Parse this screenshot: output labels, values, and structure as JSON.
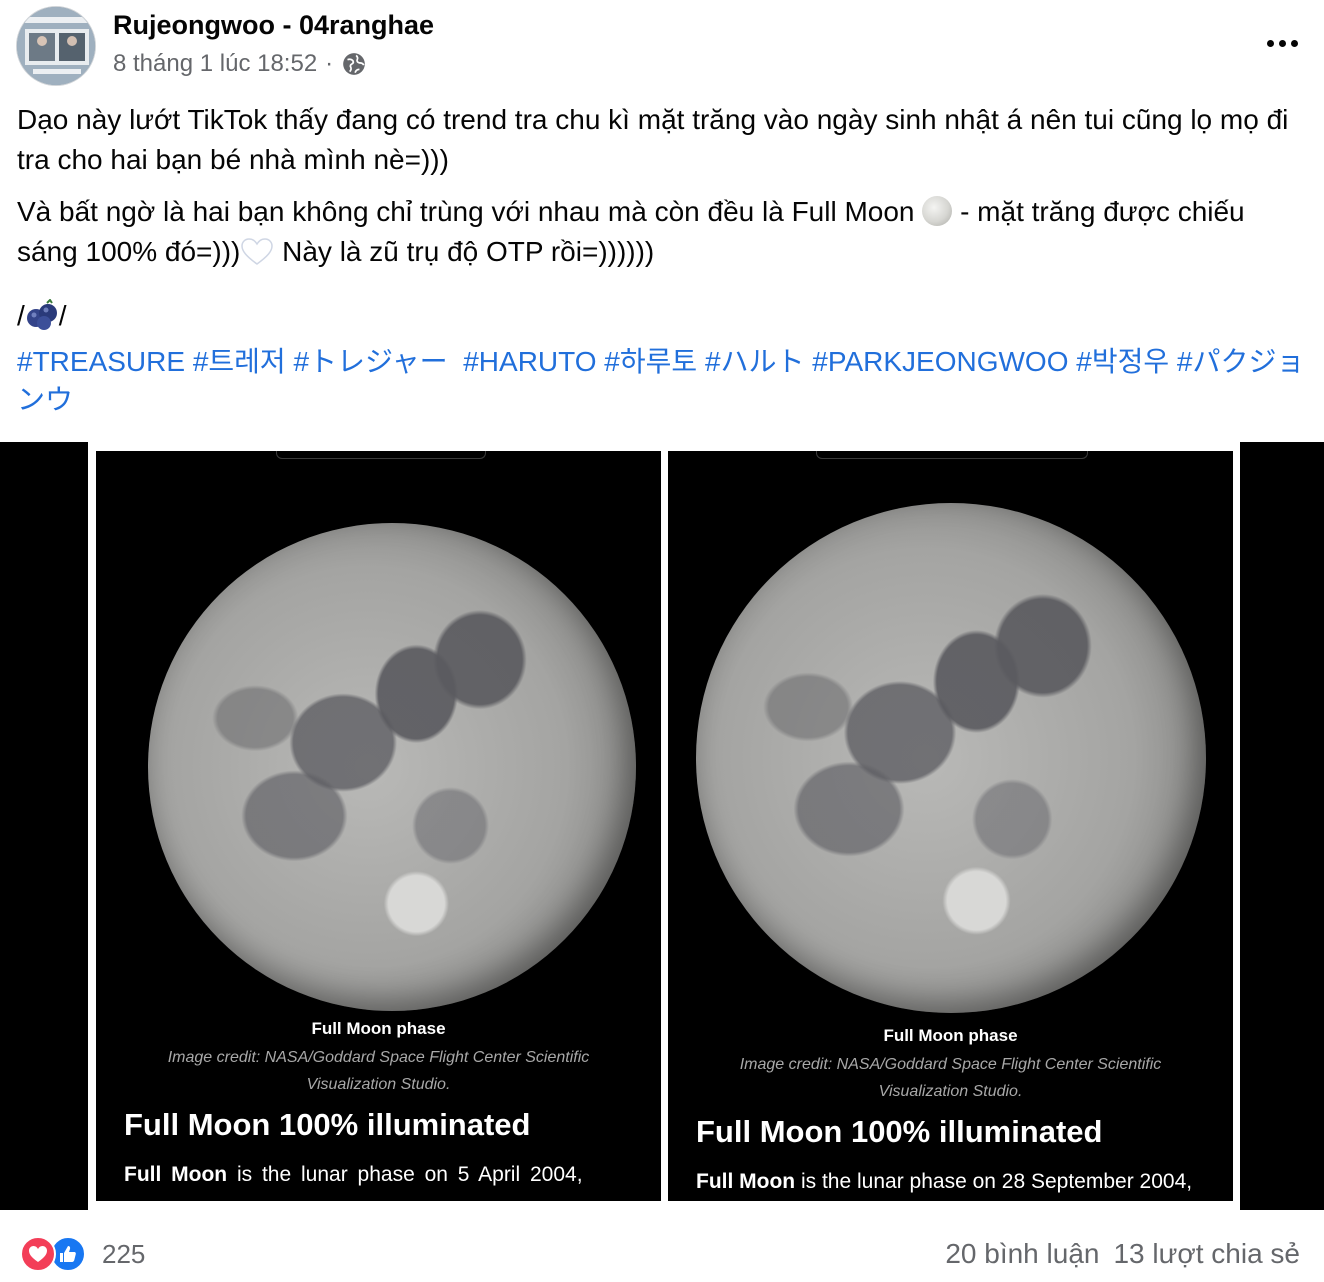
{
  "post": {
    "author": "Rujeongwoo - 04ranghae",
    "timestamp": "8 tháng 1 lúc 18:52",
    "separator": "·",
    "privacy_icon": "globe-icon",
    "more_icon": "more-options-icon",
    "body": {
      "p1": "Dạo này lướt TikTok thấy đang có trend tra chu kì mặt trăng vào ngày sinh nhật á nên tui cũng lọ mọ đi tra cho hai bạn bé nhà mình nè=)))",
      "p2_a": "Và bất ngờ là hai bạn không chỉ trùng với nhau mà còn đều là Full Moon",
      "p2_b": " - mặt trăng được chiếu sáng 100% đó=)))",
      "p2_c": " Này là zũ trụ độ OTP rồi=))))))",
      "p3_prefix": "/",
      "p3_suffix": "/"
    },
    "hashtags": [
      "#TREASURE",
      "#트레저",
      "#トレジャー",
      "#HARUTO",
      "#하루토",
      "#ハルト",
      "#PARKJEONGWOO",
      "#박정우",
      "#パクジョンウ"
    ]
  },
  "images": [
    {
      "caption_title": "Full Moon phase",
      "caption_credit": "Image credit: NASA/Goddard Space Flight Center Scientific Visualization Studio.",
      "heading": "Full Moon 100% illuminated",
      "line_bold": "Full Moon",
      "line_rest": " is the lunar phase on 5 April 2004,"
    },
    {
      "caption_title": "Full Moon phase",
      "caption_credit": "Image credit: NASA/Goddard Space Flight Center Scientific Visualization Studio.",
      "heading": "Full Moon 100% illuminated",
      "line_bold": "Full Moon",
      "line_rest": " is the lunar phase on 28 September 2004,"
    }
  ],
  "footer": {
    "reaction_icons": [
      "love-icon",
      "like-icon"
    ],
    "reaction_count": "225",
    "comments": "20 bình luận",
    "shares": "13 lượt chia sẻ"
  },
  "colors": {
    "hashtag": "#216fdb",
    "secondary_text": "#65676b",
    "love": "#f33e58",
    "like": "#1877f2"
  }
}
